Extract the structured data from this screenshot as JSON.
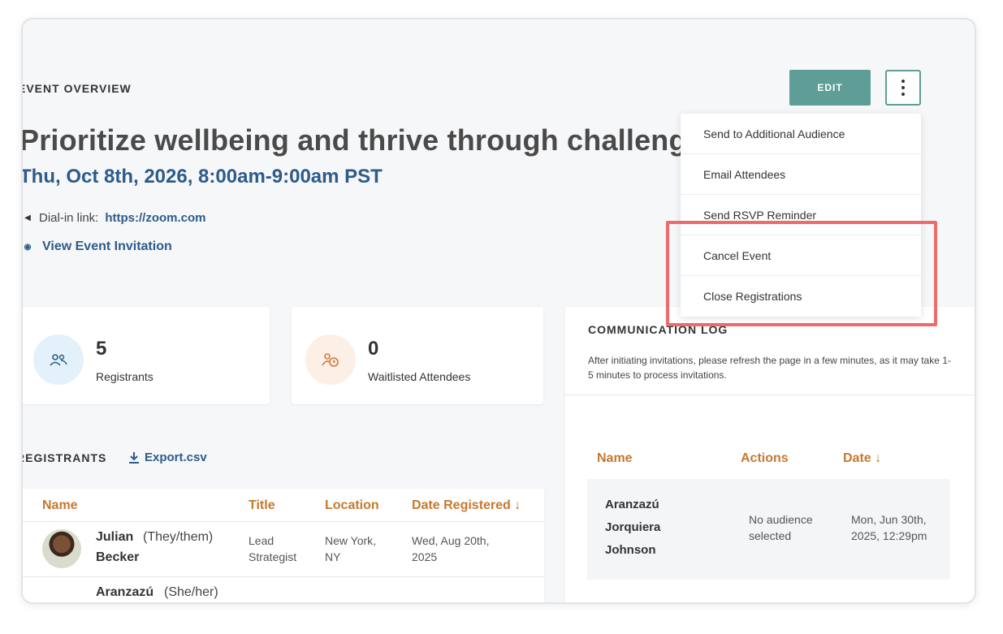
{
  "overview": {
    "label": "EVENT OVERVIEW",
    "edit_label": "EDIT",
    "more_icon": "vertical-dots-icon",
    "title": "Prioritize wellbeing and thrive through challenges",
    "datetime": "Thu, Oct 8th, 2026, 8:00am-9:00am PST",
    "dialin_label": "Dial-in link:",
    "dialin_url": "https://zoom.com",
    "view_invitation": "View Event Invitation"
  },
  "stats": [
    {
      "value": "5",
      "label": "Registrants",
      "icon": "users-icon"
    },
    {
      "value": "0",
      "label": "Waitlisted Attendees",
      "icon": "user-clock-icon"
    }
  ],
  "registrants": {
    "label": "REGISTRANTS",
    "export_label": "Export.csv",
    "columns": [
      "Name",
      "Title",
      "Location",
      "Date Registered ↓"
    ],
    "rows": [
      {
        "first": "Julian",
        "last": "Becker",
        "pronouns": "(They/them)",
        "title_l1": "Lead",
        "title_l2": "Strategist",
        "loc_l1": "New York,",
        "loc_l2": "NY",
        "date_l1": "Wed, Aug 20th,",
        "date_l2": "2025"
      },
      {
        "first": "Aranzazú",
        "pronouns": "(She/her)"
      }
    ]
  },
  "communication": {
    "title": "COMMUNICATION LOG",
    "description": "After initiating invitations, please refresh the page in a few minutes, as it may take 1-5 minutes to process invitations.",
    "columns": [
      "Name",
      "Actions",
      "Date ↓"
    ],
    "row": {
      "name_l1": "Aranzazú",
      "name_l2": "Jorquiera",
      "name_l3": "Johnson",
      "action_l1": "No audience",
      "action_l2": "selected",
      "date_l1": "Mon, Jun 30th,",
      "date_l2": "2025, 12:29pm"
    }
  },
  "menu": {
    "items": [
      "Send to Additional Audience",
      "Email Attendees",
      "Send RSVP Reminder",
      "Cancel Event",
      "Close Registrations"
    ]
  },
  "colors": {
    "accent": "#5f9e96",
    "link": "#2d5b8a",
    "column_header": "#c7782f",
    "highlight": "#ef6b6b"
  }
}
